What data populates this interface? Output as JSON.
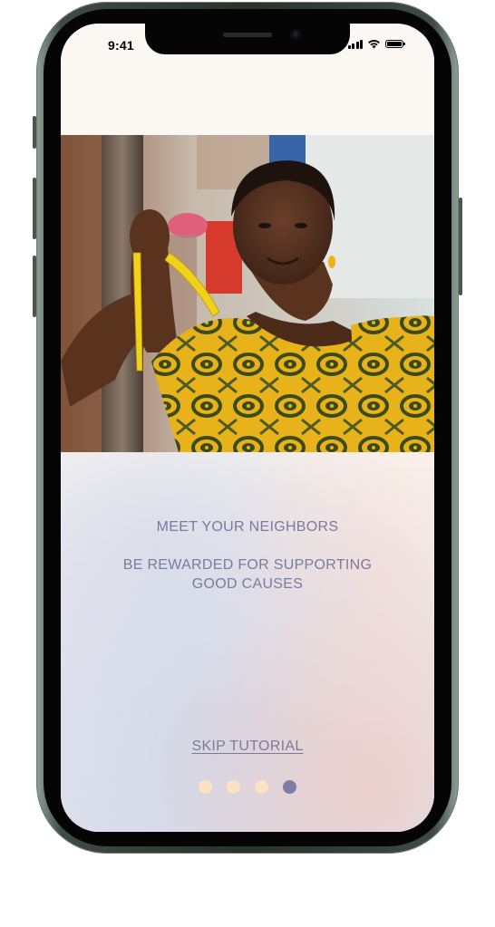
{
  "status_bar": {
    "time": "9:41"
  },
  "hero": {
    "image_description_icon": "woman-with-measuring-tape-photo"
  },
  "onboarding": {
    "headline": "MEET YOUR NEIGHBORS",
    "subline_line1": "BE REWARDED FOR SUPPORTING",
    "subline_line2": "GOOD CAUSES",
    "skip_label": "SKIP TUTORIAL"
  },
  "pager": {
    "total_pages": 4,
    "current_page": 4
  },
  "colors": {
    "text": "#7c7a9e",
    "dot_inactive": "#fbe2c2",
    "dot_active": "#7f7da6",
    "screen_bg": "#fbf8f4"
  }
}
